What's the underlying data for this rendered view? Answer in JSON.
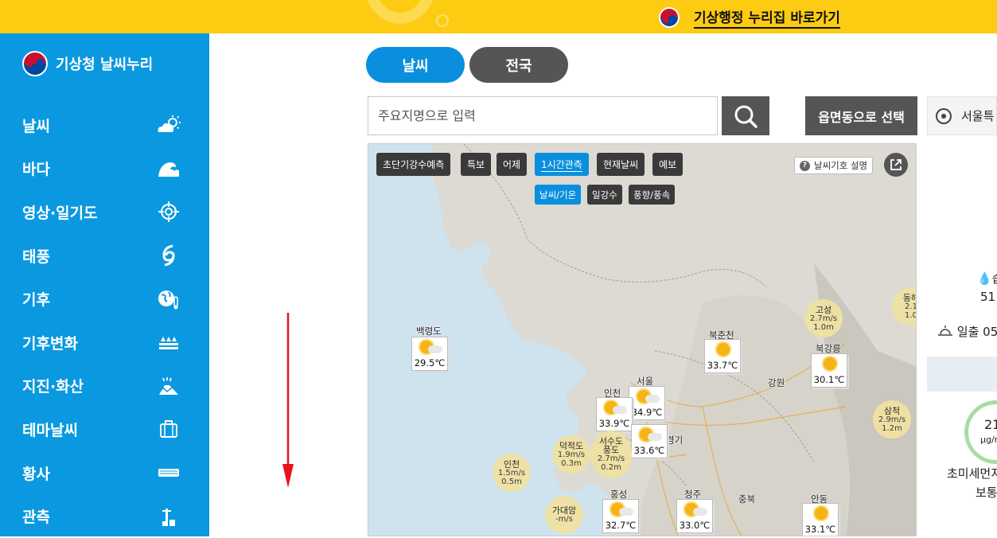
{
  "topbar": {
    "link_label": "기상행정 누리집 바로가기"
  },
  "sidebar": {
    "brand": "기상청 날씨누리",
    "items": [
      {
        "label": "날씨",
        "icon": "weather-cloud-sun-icon"
      },
      {
        "label": "바다",
        "icon": "wave-icon"
      },
      {
        "label": "영상·일기도",
        "icon": "satellite-target-icon"
      },
      {
        "label": "태풍",
        "icon": "typhoon-icon"
      },
      {
        "label": "기후",
        "icon": "globe-thermometer-icon"
      },
      {
        "label": "기후변화",
        "icon": "climate-change-icon"
      },
      {
        "label": "지진·화산",
        "icon": "earthquake-volcano-icon"
      },
      {
        "label": "테마날씨",
        "icon": "suitcase-icon"
      },
      {
        "label": "황사",
        "icon": "mask-icon"
      },
      {
        "label": "관측",
        "icon": "observation-tower-icon"
      }
    ]
  },
  "main": {
    "tabs": [
      {
        "label": "날씨"
      },
      {
        "label": "전국"
      }
    ],
    "search": {
      "placeholder": "주요지명으로 입력"
    },
    "emd_button": "읍면동으로 선택"
  },
  "map": {
    "chips_row1": [
      "초단기강수예측",
      "특보",
      "어제",
      "1시간관측",
      "현재날씨",
      "예보"
    ],
    "active_chip": "1시간관측",
    "chips_row2": [
      "날씨/기온",
      "일강수",
      "풍향/풍속"
    ],
    "active_chip2": "날씨/기온",
    "legend_button": "날씨기호 설명",
    "stations": [
      {
        "name": "백령도",
        "temp": "29.5℃"
      },
      {
        "name": "북춘천",
        "temp": "33.7℃"
      },
      {
        "name": "북강릉",
        "temp": "30.1℃"
      },
      {
        "name": "서울",
        "temp": "34.9℃"
      },
      {
        "name": "인천",
        "temp": "33.9℃"
      },
      {
        "name": "경기",
        "temp": "33.6℃"
      },
      {
        "name": "홍성",
        "temp": "32.7℃"
      },
      {
        "name": "청주",
        "temp": "33.0℃"
      },
      {
        "name": "안동",
        "temp": "33.1℃"
      }
    ],
    "wind_stations": [
      {
        "name": "고성",
        "speed": "2.7m/s",
        "wave": "1.0m"
      },
      {
        "name": "삼척",
        "speed": "2.9m/s",
        "wave": "1.2m"
      },
      {
        "name": "인천",
        "speed": "1.5m/s",
        "wave": "0.5m"
      },
      {
        "name": "덕적도",
        "speed": "1.9m/s",
        "wave": "0.3m"
      },
      {
        "name": "서수도",
        "speed": "",
        "wave": ""
      },
      {
        "name": "풍도",
        "speed": "2.7m/s",
        "wave": "0.2m"
      },
      {
        "name": "가대암",
        "speed": "-m/s",
        "wave": ""
      },
      {
        "name": "동해",
        "speed": "2.1",
        "wave": "1.0"
      }
    ],
    "place_labels": [
      "강원",
      "충북"
    ]
  },
  "right_panel": {
    "location": "서울특",
    "humidity_label": "습",
    "humidity_value": "51",
    "sunrise_label": "일출",
    "sunrise_value": "05",
    "dust_value": "21",
    "dust_unit": "μg/m",
    "dust_label": "초미세먼지",
    "dust_status": "보통"
  },
  "colors": {
    "accent": "#0a99e0",
    "topbar": "#fdcb12",
    "dark_button": "#555555",
    "arrow": "#e8141b"
  }
}
